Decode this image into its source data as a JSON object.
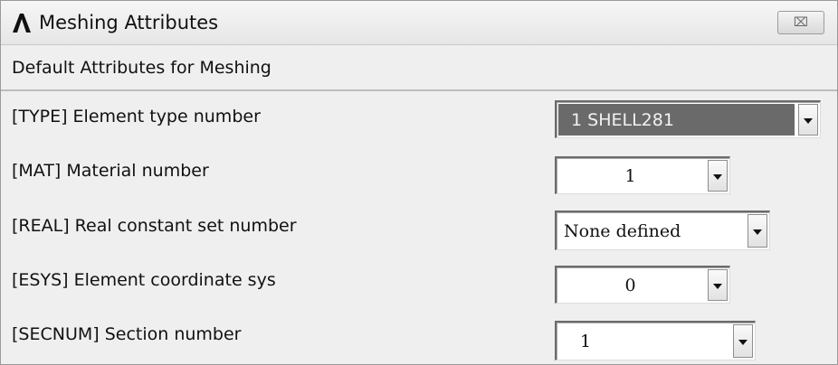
{
  "window": {
    "title": "Meshing Attributes",
    "close_label": "⌧"
  },
  "section": {
    "header": "Default Attributes for Meshing"
  },
  "fields": {
    "type": {
      "label": "[TYPE]  Element type number",
      "value": "1     SHELL281"
    },
    "mat": {
      "label": "[MAT]   Material number",
      "value": "1"
    },
    "real": {
      "label": "[REAL]  Real constant set number",
      "value": "None defined"
    },
    "esys": {
      "label": "[ESYS]  Element coordinate sys",
      "value": "0"
    },
    "secnum": {
      "label": "[SECNUM]  Section number",
      "value": "1"
    }
  },
  "icons": {
    "app": "ansys-logo-icon",
    "close": "close-icon",
    "dropdown": "chevron-down-icon"
  },
  "colors": {
    "selected_bg": "#6a6a6a",
    "window_bg": "#efefef"
  }
}
